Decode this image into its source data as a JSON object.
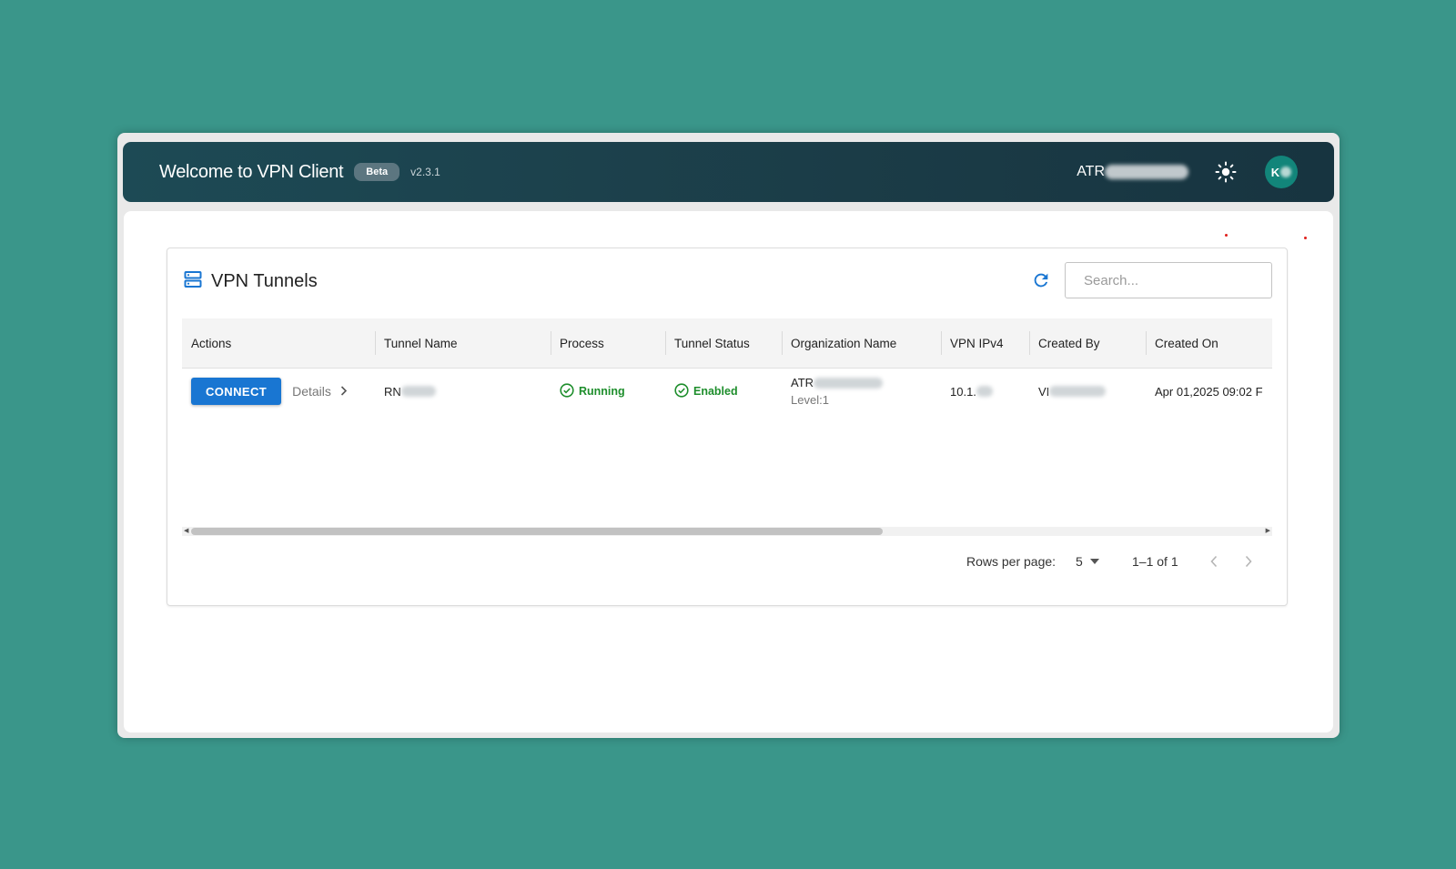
{
  "header": {
    "title": "Welcome to VPN Client",
    "badge": "Beta",
    "version": "v2.3.1",
    "org_prefix": "ATR",
    "avatar_initial": "K"
  },
  "card": {
    "title": "VPN Tunnels",
    "search_placeholder": "Search..."
  },
  "table": {
    "columns": [
      "Actions",
      "Tunnel Name",
      "Process",
      "Tunnel Status",
      "Organization Name",
      "VPN IPv4",
      "Created By",
      "Created On"
    ],
    "rows": [
      {
        "connect_label": "CONNECT",
        "details_label": "Details",
        "tunnel_name": "RN",
        "process": "Running",
        "tunnel_status": "Enabled",
        "organization_name": "ATR",
        "organization_level": "Level:1",
        "vpn_ipv4": "10.1.",
        "created_by": "VI",
        "created_on": "Apr 01,2025 09:02 F"
      }
    ]
  },
  "pagination": {
    "rows_per_page_label": "Rows per page:",
    "rows_per_page_value": "5",
    "range": "1–1 of 1"
  },
  "colors": {
    "background": "#3a968a",
    "appbar": "#1b3c47",
    "primary": "#1976d2",
    "success": "#1e8e2c",
    "avatar": "#12857a"
  }
}
